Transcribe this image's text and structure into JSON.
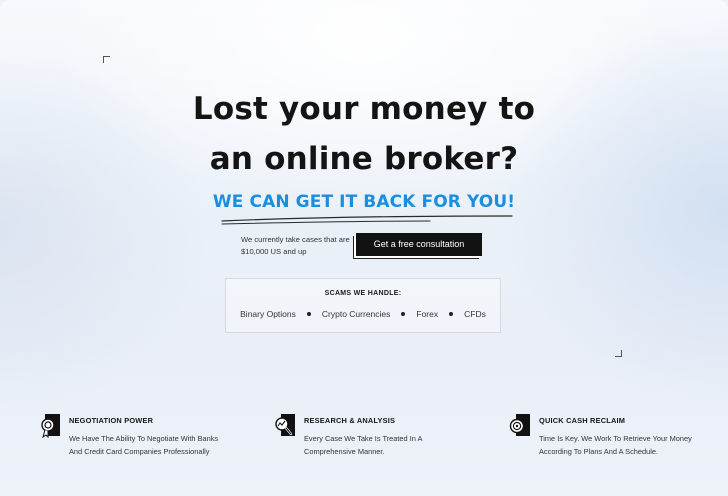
{
  "hero": {
    "title_line1": "Lost your money to",
    "title_line2": "an online broker?",
    "tagline": "WE CAN GET IT BACK FOR YOU!"
  },
  "cases": {
    "note": "We currently take cases that are $10,000 US and up",
    "cta_label": "Get a free consultation"
  },
  "scams": {
    "title": "SCAMS WE HANDLE:",
    "items": [
      "Binary Options",
      "Crypto Currencies",
      "Forex",
      "CFDs"
    ]
  },
  "features": [
    {
      "icon": "award-ribbon-icon",
      "title": "NEGOTIATION POWER",
      "description": "We Have The Ability To Negotiate With Banks And Credit Card Companies Professionally"
    },
    {
      "icon": "chart-magnifier-icon",
      "title": "RESEARCH & ANALYSIS",
      "description": "Every Case We Take Is Treated In A Comprehensive Manner."
    },
    {
      "icon": "badge-cash-icon",
      "title": "QUICK CASH RECLAIM",
      "description": "Time Is Key. We Work To Retrieve Your Money According To Plans And A Schedule."
    }
  ],
  "colors": {
    "accent": "#1a8fe0",
    "cta_bg": "#121212",
    "text": "#141414"
  }
}
